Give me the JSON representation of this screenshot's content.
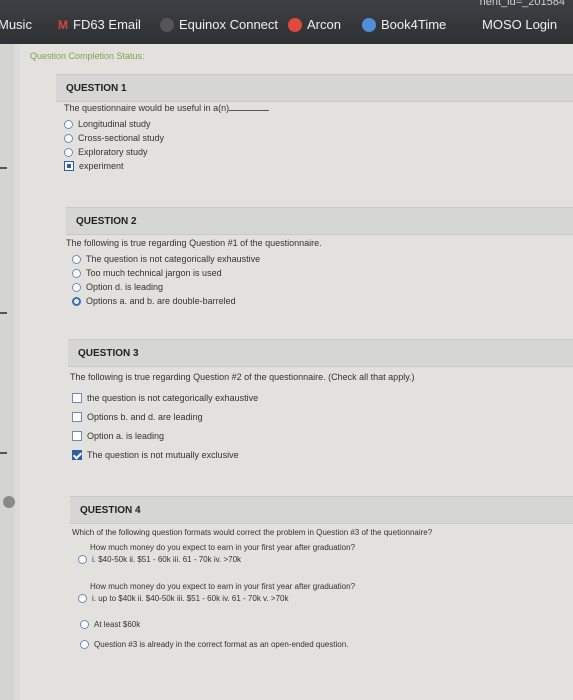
{
  "bookmarks": {
    "items": [
      {
        "label": "Music",
        "icon": "music-icon"
      },
      {
        "label": "FD63 Email",
        "icon": "gmail-icon"
      },
      {
        "label": "Equinox Connect",
        "icon": "equinox-icon"
      },
      {
        "label": "Arcon",
        "icon": "clock-icon"
      },
      {
        "label": "Book4Time",
        "icon": "globe-icon"
      },
      {
        "label": "MOSO Login",
        "icon": "moso-icon"
      }
    ],
    "url_fragment": "nent_id=_201584"
  },
  "status_link": "Question Completion Status:",
  "questions": [
    {
      "header": "QUESTION 1",
      "text": "The questionnaire would be useful in a(n)",
      "options": [
        "Longitudinal study",
        "Cross-sectional study",
        "Exploratory study",
        "experiment"
      ]
    },
    {
      "header": "QUESTION 2",
      "text": "The following is true regarding Question #1 of the questionnaire.",
      "options": [
        "The question is not categorically exhaustive",
        "Too much technical jargon is used",
        "Option d. is leading",
        "Options a. and b. are double-barreled"
      ]
    },
    {
      "header": "QUESTION 3",
      "text": "The following is true regarding Question #2 of the questionnaire. (Check all that apply.)",
      "options": [
        "the question is not categorically exhaustive",
        "Options b. and d. are leading",
        "Option a. is leading",
        "The question is not mutually exclusive"
      ]
    },
    {
      "header": "QUESTION 4",
      "text": "Which of the following question formats would correct the problem in Question #3 of the quetionnaire?",
      "sub1_q": "How much money do you expect to earn in your first year after graduation?",
      "sub1_opt": "i. $40-50k   ii. $51 - 60k   iii. 61 - 70k   iv. >70k",
      "sub2_q": "How much money do you expect to earn in your first year after graduation?",
      "sub2_opt": "i. up to $40k   ii. $40-50k   iii. $51 - 60k   iv. 61 - 70k   v. >70k",
      "opt3": "At least $60k",
      "opt4": "Question #3 is already in the correct format as an open-ended question."
    }
  ]
}
